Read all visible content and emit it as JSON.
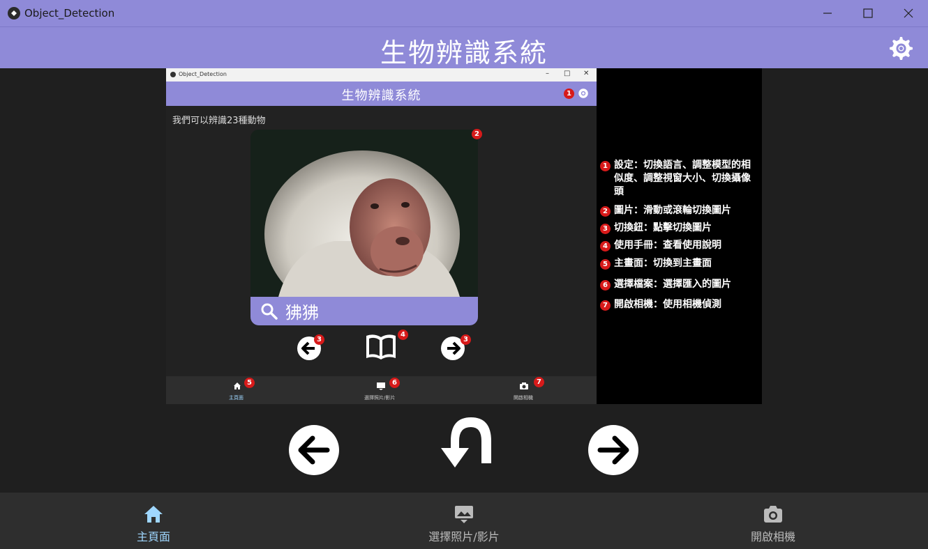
{
  "window": {
    "title": "Object_Detection"
  },
  "header": {
    "title": "生物辨識系統",
    "settings_icon": "gear-icon"
  },
  "screenshot": {
    "window_title": "Object_Detection",
    "header_title": "生物辨識系統",
    "intro_text": "我們可以辨識23種動物",
    "search_result": "狒狒",
    "nav": {
      "home": "主頁面",
      "select": "選擇照片/影片",
      "camera": "開啟相機"
    },
    "badges": [
      "1",
      "2",
      "3",
      "3",
      "4",
      "5",
      "6",
      "7"
    ]
  },
  "legend": [
    {
      "num": "1",
      "text": "設定：切換語言、調整模型的相似度、調整視窗大小、切換攝像頭"
    },
    {
      "num": "2",
      "text": "圖片：滑動或滾輪切換圖片"
    },
    {
      "num": "3",
      "text": "切換鈕：點擊切換圖片"
    },
    {
      "num": "4",
      "text": "使用手冊：查看使用說明"
    },
    {
      "num": "5",
      "text": "主畫面：切換到主畫面"
    },
    {
      "num": "6",
      "text": "選擇檔案：選擇匯入的圖片"
    },
    {
      "num": "7",
      "text": "開啟相機：使用相機偵測"
    }
  ],
  "controls": {
    "prev_icon": "arrow-left-icon",
    "back_icon": "return-icon",
    "next_icon": "arrow-right-icon"
  },
  "bottom_nav": {
    "home": "主頁面",
    "select": "選擇照片/影片",
    "camera": "開啟相機"
  },
  "colors": {
    "accent": "#8f8ad8",
    "background": "#1f1f1f",
    "nav_bg": "#2e2e2e",
    "active": "#9fd7ff",
    "badge": "#d71a1a"
  }
}
